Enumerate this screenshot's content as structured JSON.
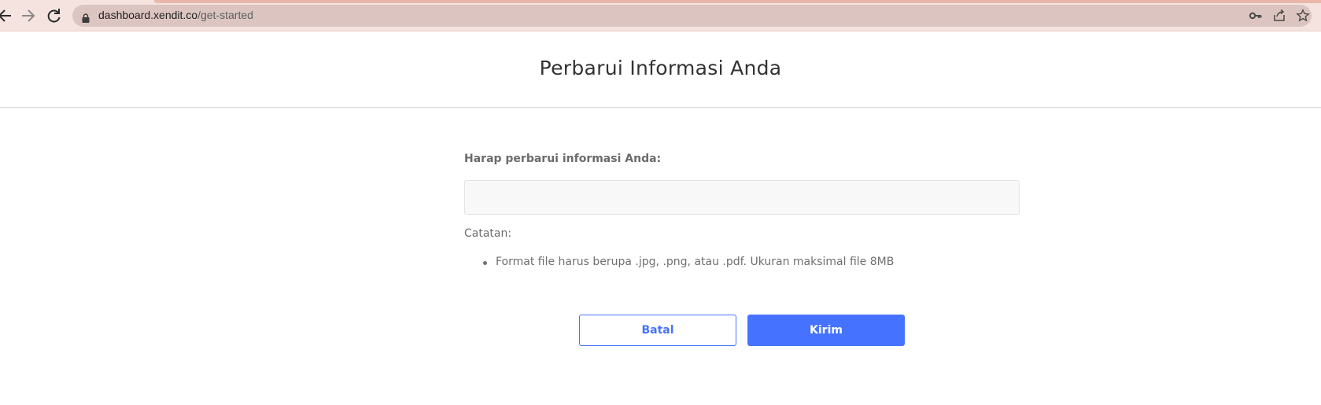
{
  "browser": {
    "url_domain": "dashboard.xendit.co",
    "url_path": "/get-started",
    "accent_color": "#e9b7aa"
  },
  "page": {
    "title": "Perbarui Informasi Anda"
  },
  "form": {
    "label": "Harap perbarui informasi Anda:",
    "upload_value": "",
    "note_label": "Catatan:",
    "notes": [
      "Format file harus berupa .jpg, .png, atau .pdf. Ukuran maksimal file 8MB"
    ]
  },
  "actions": {
    "cancel_label": "Batal",
    "submit_label": "Kirim",
    "primary_color": "#4573ff"
  },
  "icons": {
    "back": "arrow-left-icon",
    "forward": "arrow-right-icon",
    "reload": "reload-icon",
    "lock": "lock-icon",
    "key": "key-icon",
    "share": "share-icon",
    "star": "star-icon"
  }
}
